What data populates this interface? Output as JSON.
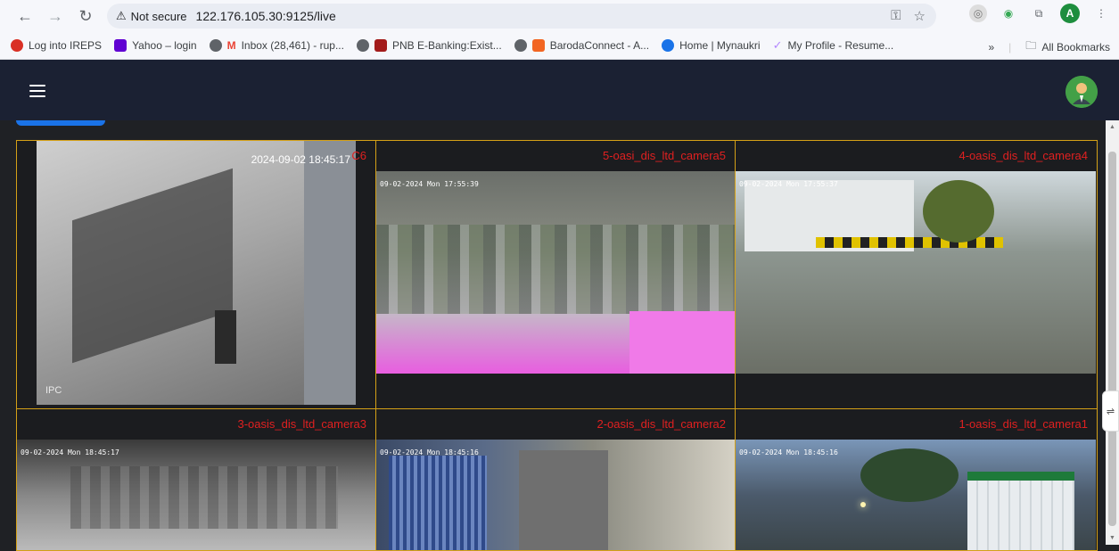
{
  "browser": {
    "secure_label": "Not secure",
    "url": "122.176.105.30:9125/live"
  },
  "bookmarks": [
    {
      "label": "Log into IREPS",
      "color": "#d93025"
    },
    {
      "label": "Yahoo – login",
      "color": "#6001d2"
    },
    {
      "label": "Inbox (28,461) - rup...",
      "color": "#ea4335"
    },
    {
      "label": "PNB E-Banking:Exist...",
      "color": "#a31b1b"
    },
    {
      "label": "BarodaConnect - A...",
      "color": "#f26522"
    },
    {
      "label": "Home | Mynaukri",
      "color": "#1a73e8"
    },
    {
      "label": "My Profile - Resume...",
      "color": "#b388ff"
    }
  ],
  "bookmarks_more": "»",
  "all_bookmarks": "All Bookmarks",
  "profile_initial": "A",
  "cameras": [
    {
      "label": "C6",
      "overlay_time": "2024-09-02 18:45:17",
      "corner_text": "IPC"
    },
    {
      "label": "5-oasi_dis_ltd_camera5",
      "stamp": "09-02-2024 Mon 17:55:39"
    },
    {
      "label": "4-oasis_dis_ltd_camera4",
      "stamp": "09-02-2024 Mon 17:55:37"
    },
    {
      "label": "3-oasis_dis_ltd_camera3",
      "stamp": "09-02-2024 Mon 18:45:17"
    },
    {
      "label": "2-oasis_dis_ltd_camera2",
      "stamp": "09-02-2024 Mon 18:45:16"
    },
    {
      "label": "1-oasis_dis_ltd_camera1",
      "stamp": "09-02-2024 Mon 18:45:16"
    }
  ]
}
